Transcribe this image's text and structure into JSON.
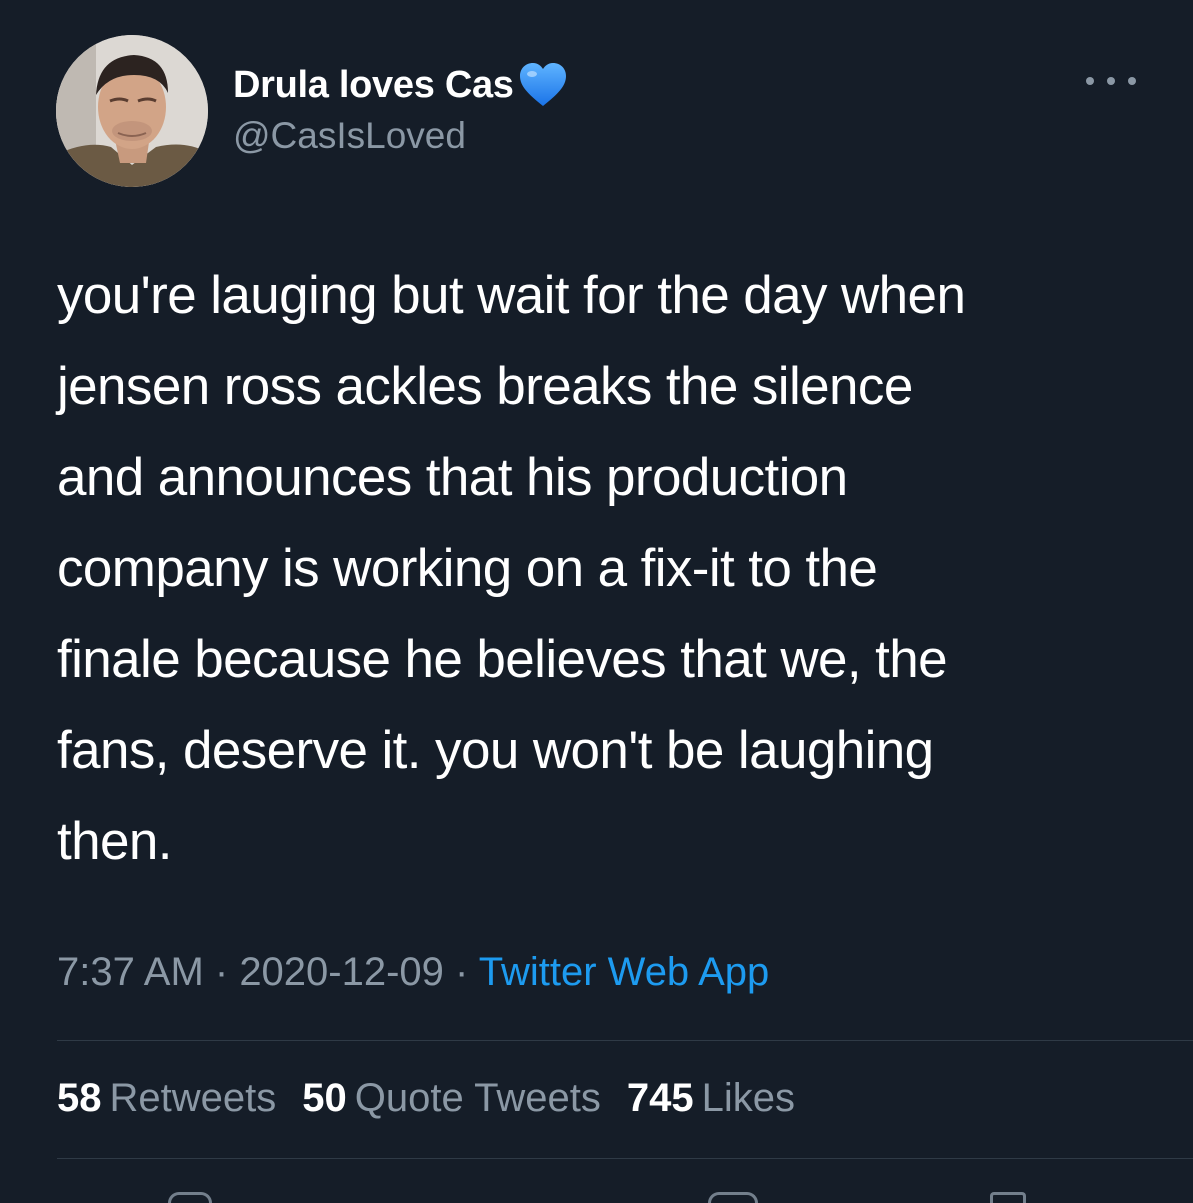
{
  "user": {
    "display_name": "Drula loves Cas",
    "emoji": "blue-heart",
    "handle": "@CasIsLoved"
  },
  "tweet": {
    "text": "you're lauging but wait for the day when\njensen ross ackles breaks the silence\nand announces that his production\ncompany is working on a fix-it to the\nfinale because he believes that we, the\nfans, deserve it. you won't be laughing\nthen."
  },
  "meta": {
    "time": "7:37 AM",
    "separator": " · ",
    "date": "2020-12-09",
    "source": "Twitter Web App"
  },
  "stats": {
    "retweets_count": "58",
    "retweets_label": "Retweets",
    "quotes_count": "50",
    "quotes_label": "Quote Tweets",
    "likes_count": "745",
    "likes_label": "Likes"
  },
  "colors": {
    "background": "#151d28",
    "text": "#ffffff",
    "secondary": "#8b98a5",
    "link": "#1d9bf0",
    "heart": "#1f8bff"
  }
}
